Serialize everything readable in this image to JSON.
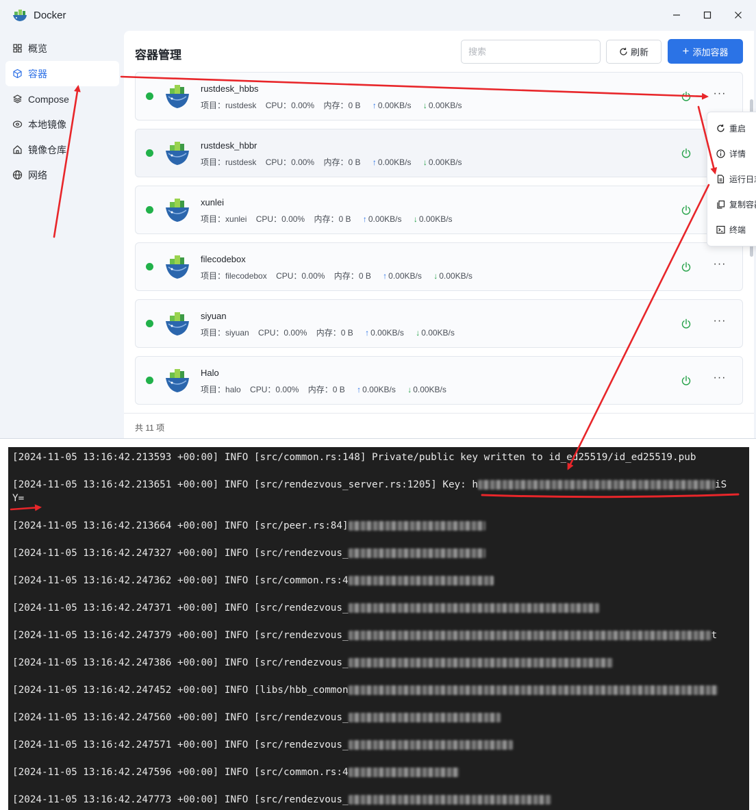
{
  "window": {
    "title": "Docker"
  },
  "sidebar": {
    "items": [
      {
        "label": "概览",
        "icon": "grid-icon"
      },
      {
        "label": "容器",
        "icon": "cube-icon",
        "active": true
      },
      {
        "label": "Compose",
        "icon": "layers-icon"
      },
      {
        "label": "本地镜像",
        "icon": "disc-icon"
      },
      {
        "label": "镜像仓库",
        "icon": "home-icon"
      },
      {
        "label": "网络",
        "icon": "globe-icon"
      }
    ]
  },
  "main": {
    "title": "容器管理",
    "search_placeholder": "搜索",
    "refresh_label": "刷新",
    "add_label": "添加容器",
    "count_label": "共 11 项",
    "labels": {
      "project": "项目：",
      "cpu": "CPU：",
      "mem": "内存："
    },
    "containers": [
      {
        "name": "rustdesk_hbbs",
        "project": "rustdesk",
        "cpu": "0.00%",
        "mem": "0 B",
        "up": "0.00KB/s",
        "down": "0.00KB/s"
      },
      {
        "name": "rustdesk_hbbr",
        "project": "rustdesk",
        "cpu": "0.00%",
        "mem": "0 B",
        "up": "0.00KB/s",
        "down": "0.00KB/s"
      },
      {
        "name": "xunlei",
        "project": "xunlei",
        "cpu": "0.00%",
        "mem": "0 B",
        "up": "0.00KB/s",
        "down": "0.00KB/s"
      },
      {
        "name": "filecodebox",
        "project": "filecodebox",
        "cpu": "0.00%",
        "mem": "0 B",
        "up": "0.00KB/s",
        "down": "0.00KB/s"
      },
      {
        "name": "siyuan",
        "project": "siyuan",
        "cpu": "0.00%",
        "mem": "0 B",
        "up": "0.00KB/s",
        "down": "0.00KB/s"
      },
      {
        "name": "Halo",
        "project": "halo",
        "cpu": "0.00%",
        "mem": "0 B",
        "up": "0.00KB/s",
        "down": "0.00KB/s"
      }
    ]
  },
  "menu": {
    "items": [
      {
        "label": "重启",
        "icon": "restart-icon"
      },
      {
        "label": "详情",
        "icon": "info-icon"
      },
      {
        "label": "运行日志",
        "icon": "document-icon"
      },
      {
        "label": "复制容器",
        "icon": "copy-icon"
      },
      {
        "label": "终端",
        "icon": "terminal-icon"
      }
    ]
  },
  "logs": [
    {
      "text": "[2024-11-05 13:16:42.213593 +00:00] INFO [src/common.rs:148] Private/public key written to id_ed25519/id_ed25519.pub"
    },
    {
      "text": "[2024-11-05 13:16:42.213651 +00:00] INFO [src/rendezvous_server.rs:1205] Key: h",
      "tail": "iS",
      "line2": "Y="
    },
    {
      "text": "[2024-11-05 13:16:42.213664 +00:00] INFO [src/peer.rs:84]"
    },
    {
      "text": "[2024-11-05 13:16:42.247327 +00:00] INFO [src/rendezvous_"
    },
    {
      "text": "[2024-11-05 13:16:42.247362 +00:00] INFO [src/common.rs:4"
    },
    {
      "text": "[2024-11-05 13:16:42.247371 +00:00] INFO [src/rendezvous_"
    },
    {
      "text": "[2024-11-05 13:16:42.247379 +00:00] INFO [src/rendezvous_",
      "tail": "t"
    },
    {
      "text": "[2024-11-05 13:16:42.247386 +00:00] INFO [src/rendezvous_"
    },
    {
      "text": "[2024-11-05 13:16:42.247452 +00:00] INFO [libs/hbb_common"
    },
    {
      "text": "[2024-11-05 13:16:42.247560 +00:00] INFO [src/rendezvous_"
    },
    {
      "text": "[2024-11-05 13:16:42.247571 +00:00] INFO [src/rendezvous_"
    },
    {
      "text": "[2024-11-05 13:16:42.247596 +00:00] INFO [src/common.rs:4"
    },
    {
      "text": "[2024-11-05 13:16:42.247773 +00:00] INFO [src/rendezvous_"
    }
  ],
  "colors": {
    "accent": "#2b73e6",
    "running": "#21b14a",
    "annotation": "#e8262a"
  }
}
